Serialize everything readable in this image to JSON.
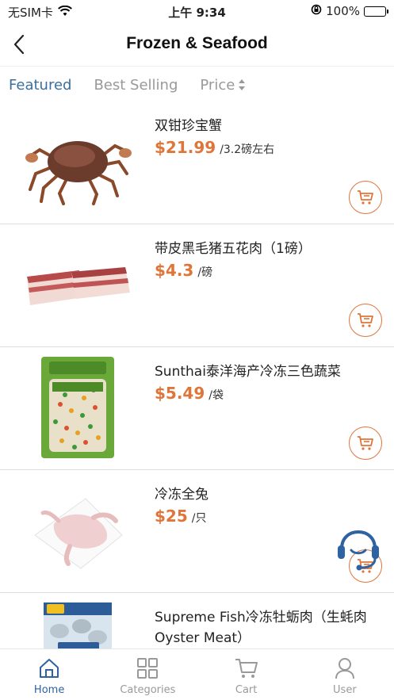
{
  "status_bar": {
    "carrier": "无SIM卡",
    "time": "上午 9:34",
    "battery": "100%",
    "battery_level": 1.0
  },
  "header": {
    "title": "Frozen & Seafood",
    "back_icon": "chevron-left-icon"
  },
  "sort": {
    "featured": "Featured",
    "best_selling": "Best Selling",
    "price": "Price"
  },
  "products": [
    {
      "name": "双钳珍宝蟹",
      "price": "$21.99",
      "unit": "/3.2磅左右"
    },
    {
      "name": "带皮黑毛猪五花肉（1磅）",
      "price": "$4.3",
      "unit": "/磅"
    },
    {
      "name": "Sunthai泰洋海产冷冻三色蔬菜",
      "price": "$5.49",
      "unit": "/袋"
    },
    {
      "name": "冷冻全兔",
      "price": "$25",
      "unit": "/只"
    },
    {
      "name": "Supreme Fish冷冻牡蛎肉（生蚝肉 Oyster Meat）",
      "price": "",
      "unit": ""
    }
  ],
  "tabs": [
    {
      "label": "Home",
      "icon": "home-icon"
    },
    {
      "label": "Categories",
      "icon": "grid-icon"
    },
    {
      "label": "Cart",
      "icon": "cart-icon"
    },
    {
      "label": "User",
      "icon": "user-icon"
    }
  ],
  "colors": {
    "accent": "#e0753a",
    "primary": "#2f62a0",
    "inactive": "#999999"
  }
}
